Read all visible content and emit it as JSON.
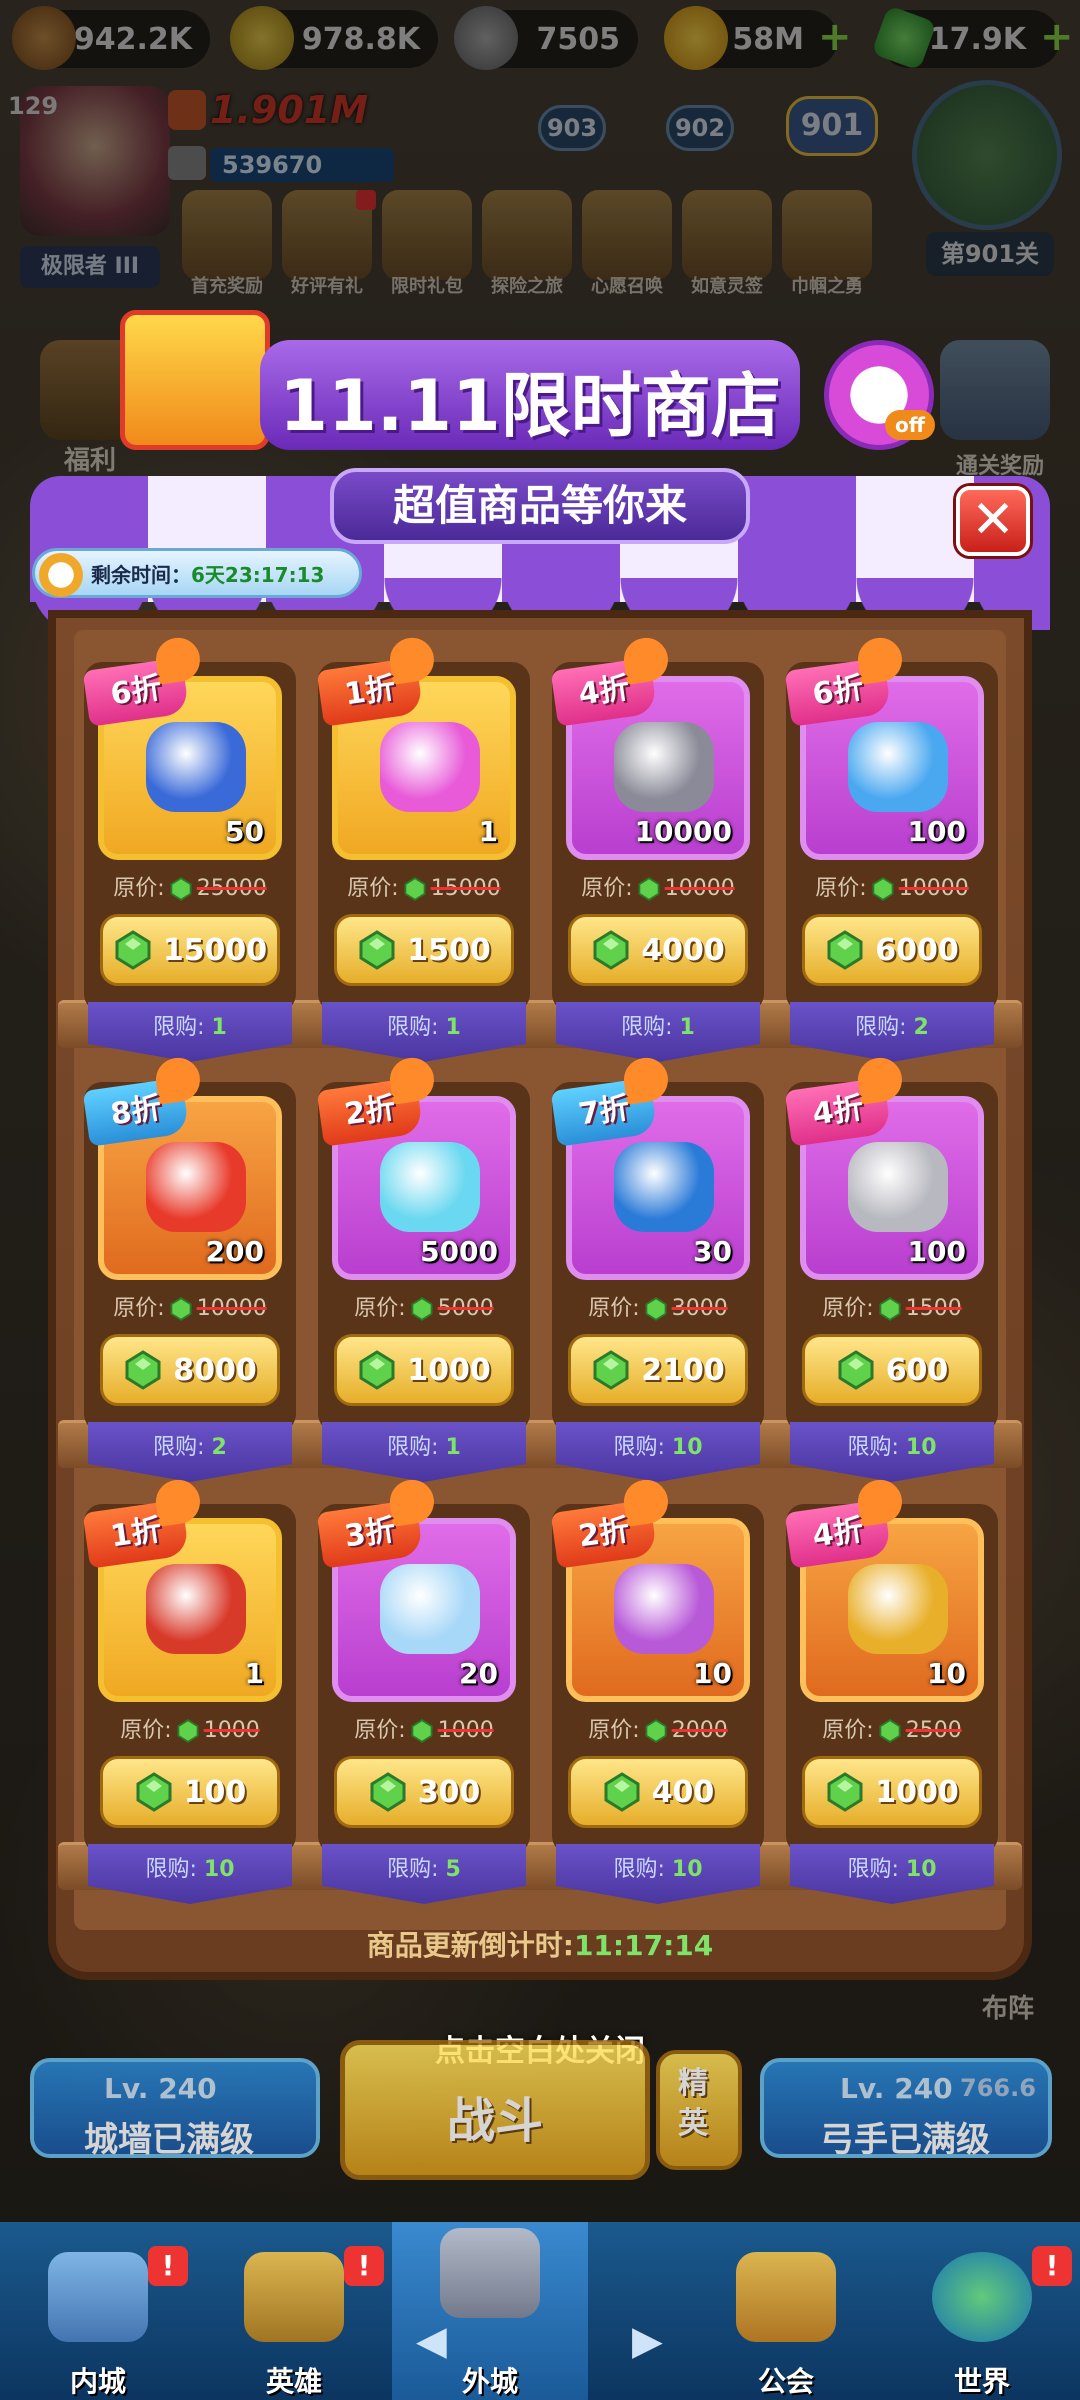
{
  "resources": [
    {
      "icon": "wood-icon",
      "value": "942.2K"
    },
    {
      "icon": "star-coin-icon",
      "value": "978.8K"
    },
    {
      "icon": "stone-icon",
      "value": "7505"
    },
    {
      "icon": "gold-coin-icon",
      "value": "58M"
    },
    {
      "icon": "gem-icon",
      "value": "17.9K"
    }
  ],
  "player": {
    "level": "129",
    "power": "1.901M",
    "sub_power": "539670",
    "rank": "极限者 III"
  },
  "stages": [
    "903",
    "902",
    "901"
  ],
  "stage_label": "第901关",
  "top_events": [
    "首充奖励",
    "好评有礼",
    "限时礼包",
    "探险之旅",
    "心愿召唤",
    "如意灵签",
    "巾帼之勇"
  ],
  "side_labels": {
    "left": "福利",
    "right": "通关奖励",
    "formation": "布阵"
  },
  "shop": {
    "banner_title": "11.11限时商店",
    "subtitle": "超值商品等你来",
    "off_tag": "off",
    "remaining_label": "剩余时间：",
    "remaining_value": "6天23:17:13",
    "close_label": "✕",
    "orig_label": "原价:",
    "limit_label": "限购:",
    "refresh_label": "商品更新倒计时:",
    "refresh_value": "11:17:14",
    "items": [
      {
        "discount": "6折",
        "qty": "50",
        "orig": "25000",
        "price": "15000",
        "limit": "1",
        "tile": "gold",
        "badge": "pink",
        "icon": "puzzle-icon",
        "art": "#3a6ad8"
      },
      {
        "discount": "1折",
        "qty": "1",
        "orig": "15000",
        "price": "1500",
        "limit": "1",
        "tile": "gold",
        "badge": "red",
        "icon": "gift-box-icon",
        "art": "#e85ad8"
      },
      {
        "discount": "4折",
        "qty": "10000",
        "orig": "10000",
        "price": "4000",
        "limit": "1",
        "tile": "purple",
        "badge": "pink",
        "icon": "rune-stone-icon",
        "art": "#8a8a98"
      },
      {
        "discount": "6折",
        "qty": "100",
        "orig": "10000",
        "price": "6000",
        "limit": "2",
        "tile": "purple",
        "badge": "pink",
        "icon": "potion-icon",
        "art": "#4aa8f0"
      },
      {
        "discount": "8折",
        "qty": "200",
        "orig": "10000",
        "price": "8000",
        "limit": "2",
        "tile": "orange",
        "badge": "blue",
        "icon": "fire-crystal-icon",
        "art": "#e83a2a"
      },
      {
        "discount": "2折",
        "qty": "5000",
        "orig": "5000",
        "price": "1000",
        "limit": "1",
        "tile": "purple",
        "badge": "red",
        "icon": "ice-crystal-icon",
        "art": "#6ad8f0"
      },
      {
        "discount": "7折",
        "qty": "30",
        "orig": "3000",
        "price": "2100",
        "limit": "10",
        "tile": "purple",
        "badge": "blue",
        "icon": "blue-gem-icon",
        "art": "#2a7ad8"
      },
      {
        "discount": "4折",
        "qty": "100",
        "orig": "1500",
        "price": "600",
        "limit": "10",
        "tile": "purple",
        "badge": "pink",
        "icon": "iron-ore-icon",
        "art": "#b8b8c0"
      },
      {
        "discount": "1折",
        "qty": "1",
        "orig": "1000",
        "price": "100",
        "limit": "10",
        "tile": "gold",
        "badge": "red",
        "icon": "red-scroll-icon",
        "art": "#d83a2a"
      },
      {
        "discount": "3折",
        "qty": "20",
        "orig": "1000",
        "price": "300",
        "limit": "5",
        "tile": "purple",
        "badge": "red",
        "icon": "crystal-shards-icon",
        "art": "#a8d8f8"
      },
      {
        "discount": "2折",
        "qty": "10",
        "orig": "2000",
        "price": "400",
        "limit": "10",
        "tile": "orange",
        "badge": "red",
        "icon": "purple-scroll-icon",
        "art": "#b85ad8"
      },
      {
        "discount": "4折",
        "qty": "10",
        "orig": "2500",
        "price": "1000",
        "limit": "10",
        "tile": "orange",
        "badge": "pink",
        "icon": "golden-ticket-icon",
        "art": "#e8b02a"
      }
    ]
  },
  "close_hint": "点击空白处关闭",
  "bottom": {
    "wall": {
      "level": "Lv. 240",
      "status": "城墙已满级"
    },
    "battle": "战斗",
    "elite": "精英",
    "archer": {
      "level": "Lv. 240",
      "power": "766.6",
      "status": "弓手已满级"
    }
  },
  "nav": [
    "内城",
    "英雄",
    "外城",
    "公会",
    "世界"
  ],
  "colors": {
    "accent_purple": "#8a4fd6",
    "gem_green": "#5fd14a",
    "price_gold": "#f0b02a",
    "limit_green": "#7fe36a"
  }
}
